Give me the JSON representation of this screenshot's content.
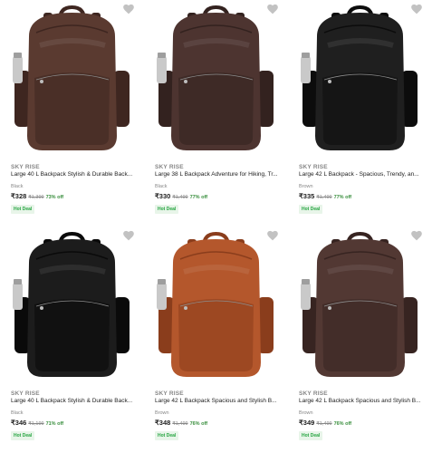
{
  "colors": {
    "price": "#212121",
    "muted": "#878787",
    "discount": "#388e3c",
    "deal_text": "#26a541",
    "deal_bg": "#e8f5e9",
    "wishlist": "#c2c2c2"
  },
  "products": [
    {
      "brand": "SKY RISE",
      "title": "Large 40 L Backpack Stylish & Durable Back...",
      "color": "Black",
      "price": "₹328",
      "mrp": "₹1,399",
      "discount": "73% off",
      "badge": "Hot Deal",
      "bag_color": "#5a3a30",
      "bag_shade": "#3e2620",
      "icon": "heart-icon"
    },
    {
      "brand": "SKY RISE",
      "title": "Large 38 L Backpack Adventure for Hiking, Tr...",
      "color": "Black",
      "price": "₹330",
      "mrp": "₹1,499",
      "discount": "77% off",
      "badge": "Hot Deal",
      "bag_color": "#4d3430",
      "bag_shade": "#33221f",
      "icon": "heart-icon"
    },
    {
      "brand": "SKY RISE",
      "title": "Large 42 L Backpack - Spacious, Trendy, an...",
      "color": "Brown",
      "price": "₹335",
      "mrp": "₹1,499",
      "discount": "77% off",
      "badge": "Hot Deal",
      "bag_color": "#1f1f1f",
      "bag_shade": "#0c0c0c",
      "icon": "heart-icon"
    },
    {
      "brand": "SKY RISE",
      "title": "Large 40 L Backpack Stylish & Durable Back...",
      "color": "Black",
      "price": "₹346",
      "mrp": "₹1,199",
      "discount": "71% off",
      "badge": "Hot Deal",
      "bag_color": "#1c1c1c",
      "bag_shade": "#0a0a0a",
      "icon": "heart-icon"
    },
    {
      "brand": "SKY RISE",
      "title": "Large 42 L Backpack Spacious and Stylish B...",
      "color": "Brown",
      "price": "₹348",
      "mrp": "₹1,499",
      "discount": "76% off",
      "badge": "Hot Deal",
      "bag_color": "#b4572c",
      "bag_shade": "#8a3d1c",
      "icon": "heart-icon"
    },
    {
      "brand": "SKY RISE",
      "title": "Large 42 L Backpack Spacious and Stylish B...",
      "color": "Brown",
      "price": "₹349",
      "mrp": "₹1,499",
      "discount": "76% off",
      "badge": "Hot Deal",
      "bag_color": "#523833",
      "bag_shade": "#372421",
      "icon": "heart-icon"
    }
  ]
}
